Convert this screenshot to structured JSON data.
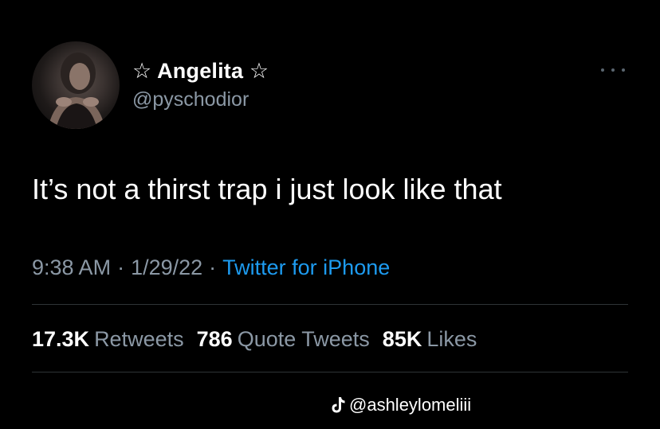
{
  "tweet": {
    "display_name": "☆ Angelita ☆",
    "handle": "@pyschodior",
    "text": "It’s not a thirst trap i just look like that",
    "time": "9:38 AM",
    "date": "1/29/22",
    "separator": "·",
    "source": "Twitter for iPhone",
    "stats": {
      "retweets_count": "17.3K",
      "retweets_label": "Retweets",
      "quotes_count": "786",
      "quotes_label": "Quote Tweets",
      "likes_count": "85K",
      "likes_label": "Likes"
    }
  },
  "watermark": {
    "icon": "tiktok-icon",
    "text": "@ashleylomeliii"
  },
  "colors": {
    "background": "#000000",
    "primary_text": "#ffffff",
    "secondary_text": "#8b98a5",
    "link": "#1d9bf0",
    "divider": "#2f3336"
  }
}
